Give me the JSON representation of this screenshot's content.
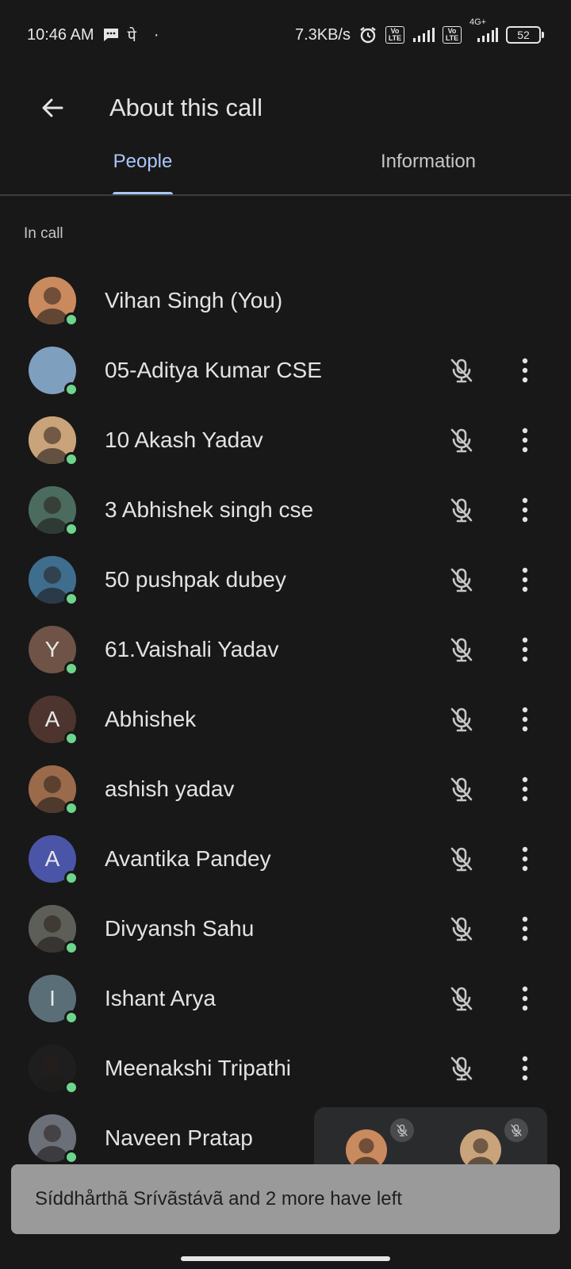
{
  "status_bar": {
    "time": "10:46 AM",
    "hindi_glyph": "पे",
    "dot": "·",
    "speed": "7.3KB/s",
    "volte_label": "Vo LTE",
    "network": "4G+",
    "battery": "52",
    "icons": [
      "message-icon",
      "alarm-icon",
      "signal-icon",
      "battery-icon"
    ]
  },
  "app_bar": {
    "title": "About this call",
    "back_icon": "arrow-left-icon"
  },
  "tabs": [
    {
      "label": "People",
      "active": true
    },
    {
      "label": "Information",
      "active": false
    }
  ],
  "section": {
    "label": "In call"
  },
  "people": [
    {
      "name": "Vihan Singh (You)",
      "avatar": "photo",
      "initial": "",
      "bg": "#c98a5e",
      "show_actions": false
    },
    {
      "name": "05-Aditya Kumar CSE",
      "avatar": "plain",
      "initial": "",
      "bg": "#7f9fbf",
      "show_actions": true
    },
    {
      "name": "10 Akash Yadav",
      "avatar": "photo",
      "initial": "",
      "bg": "#c9a37a",
      "show_actions": true
    },
    {
      "name": "3 Abhishek singh cse",
      "avatar": "photo",
      "initial": "",
      "bg": "#4b6b5e",
      "show_actions": true
    },
    {
      "name": "50 pushpak dubey",
      "avatar": "photo",
      "initial": "",
      "bg": "#3f6d8e",
      "show_actions": true
    },
    {
      "name": "61.Vaishali Yadav",
      "avatar": "letter",
      "initial": "Y",
      "bg": "#6e5346",
      "show_actions": true
    },
    {
      "name": "Abhishek",
      "avatar": "letter",
      "initial": "A",
      "bg": "#4e342e",
      "show_actions": true
    },
    {
      "name": "ashish yadav",
      "avatar": "photo",
      "initial": "",
      "bg": "#9a6a4a",
      "show_actions": true
    },
    {
      "name": "Avantika Pandey",
      "avatar": "letter",
      "initial": "A",
      "bg": "#4a55a8",
      "show_actions": true
    },
    {
      "name": "Divyansh Sahu",
      "avatar": "photo",
      "initial": "",
      "bg": "#5e5e58",
      "show_actions": true
    },
    {
      "name": "Ishant Arya",
      "avatar": "letter",
      "initial": "I",
      "bg": "#5a6e78",
      "show_actions": true
    },
    {
      "name": "Meenakshi Tripathi",
      "avatar": "photo",
      "initial": "",
      "bg": "#1e1e1e",
      "show_actions": true
    },
    {
      "name": "Naveen Pratap",
      "avatar": "photo",
      "initial": "",
      "bg": "#6a6f78",
      "show_actions": false
    }
  ],
  "pip": {
    "tiles": [
      {
        "bg": "#c98a5e",
        "muted": true
      },
      {
        "bg": "#c9a37a",
        "muted": true
      }
    ]
  },
  "toast": {
    "text": "Síddhårthã Srívãstávã and 2 more have left"
  }
}
